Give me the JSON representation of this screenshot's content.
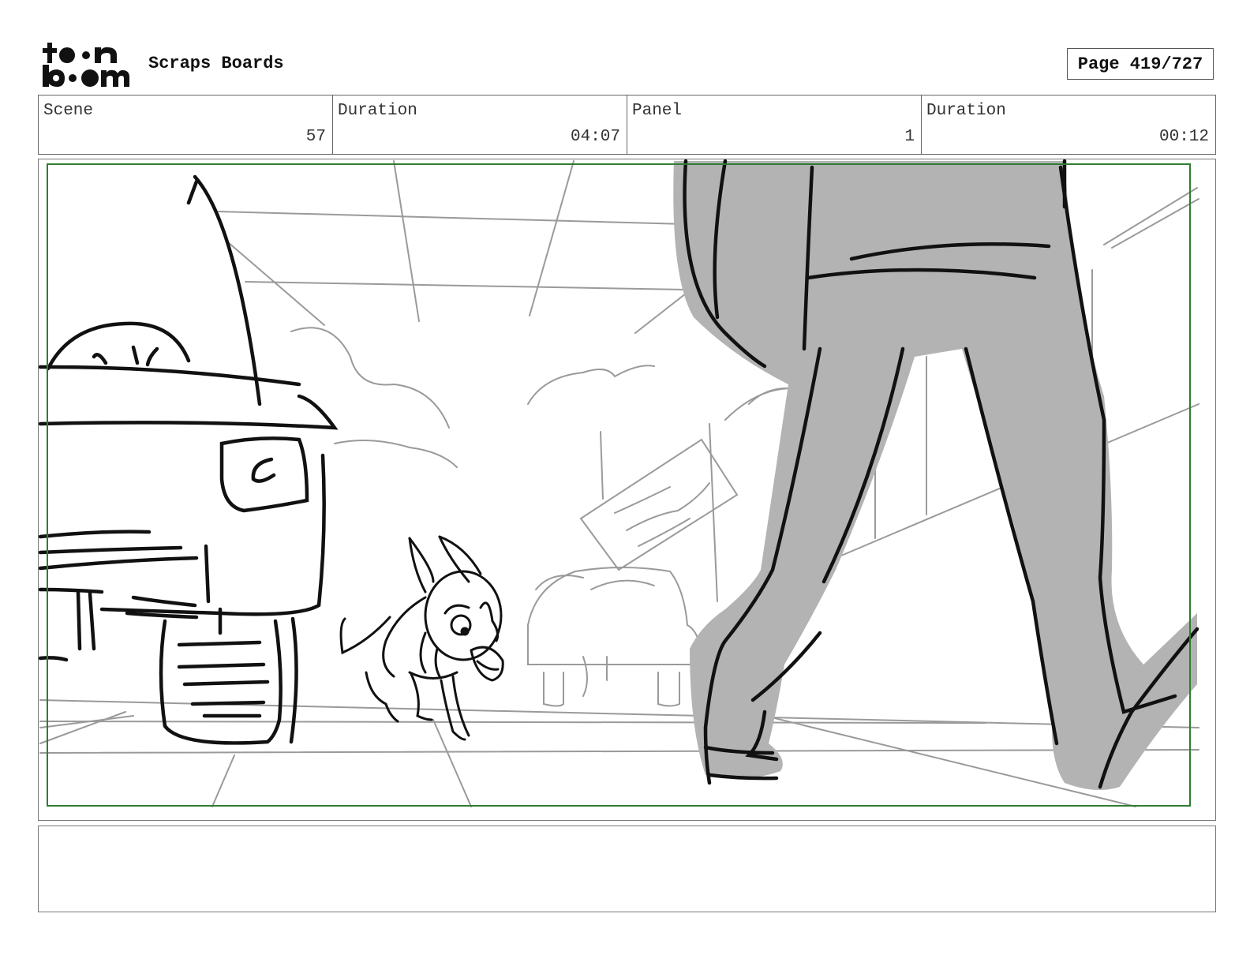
{
  "header": {
    "logo_text": "toon boom",
    "title": "Scraps Boards",
    "page_indicator": "Page 419/727"
  },
  "info": {
    "scene_label": "Scene",
    "scene_value": "57",
    "scene_duration_label": "Duration",
    "scene_duration_value": "04:07",
    "panel_label": "Panel",
    "panel_value": "1",
    "panel_duration_label": "Duration",
    "panel_duration_value": "00:12"
  },
  "colors": {
    "safe_frame": "#2e7d32",
    "figure_fill": "#b3b3b3",
    "ink": "#111111",
    "pencil": "#9a9a9a"
  },
  "notes": {
    "text": ""
  }
}
